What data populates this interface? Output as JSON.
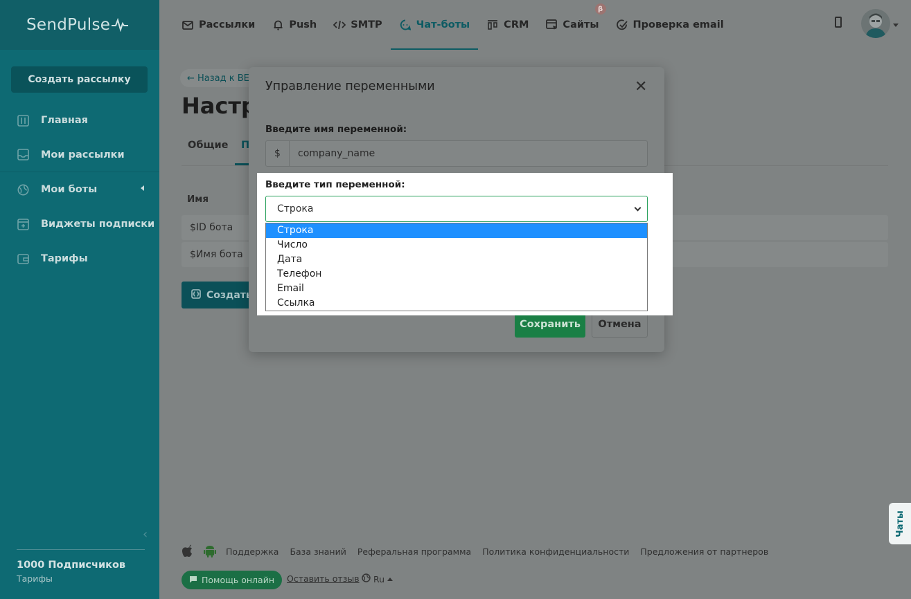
{
  "brand": {
    "logo_text": "SendPulse"
  },
  "sidebar": {
    "create_button": "Создать рассылку",
    "items": [
      {
        "label": "Главная",
        "icon": "dashboard-icon"
      },
      {
        "label": "Мои рассылки",
        "icon": "mailings-icon"
      },
      {
        "label": "Мои боты",
        "icon": "globe-icon"
      },
      {
        "label": "Виджеты подписки",
        "icon": "widget-icon"
      },
      {
        "label": "Тарифы",
        "icon": "wallet-icon"
      }
    ],
    "subscribers": "1000 Подписчиков",
    "tariffs_link": "Тарифы"
  },
  "topnav": {
    "items": [
      {
        "label": "Рассылки",
        "icon": "mail-icon"
      },
      {
        "label": "Push",
        "icon": "bell-icon"
      },
      {
        "label": "SMTP",
        "icon": "code-icon"
      },
      {
        "label": "Чат-боты",
        "icon": "chat-icon"
      },
      {
        "label": "CRM",
        "icon": "crm-icon"
      },
      {
        "label": "Сайты",
        "icon": "site-icon"
      },
      {
        "label": "Проверка email",
        "icon": "check-icon"
      }
    ],
    "beta_badge": "β"
  },
  "page": {
    "back_link": "← Назад к ВЕ",
    "title": "Настро",
    "tabs": [
      "Общие",
      "П"
    ],
    "column_header": "Имя",
    "rows": [
      "$ID бота",
      "$Имя бота"
    ],
    "create_button": "Создать"
  },
  "modal": {
    "title": "Управление переменными",
    "name_label": "Введите имя переменной:",
    "name_prefix": "$",
    "name_value": "company_name",
    "type_label": "Введите тип переменной:",
    "type_selected": "Строка",
    "type_options": [
      "Строка",
      "Число",
      "Дата",
      "Телефон",
      "Email",
      "Ссылка"
    ],
    "save_button": "Сохранить",
    "cancel_button": "Отмена"
  },
  "footer": {
    "links": [
      "Поддержка",
      "База знаний",
      "Реферальная программа",
      "Политика конфиденциальности",
      "Предложения от партнеров"
    ],
    "help_online": "Помощь онлайн",
    "feedback": "Оставить отзыв",
    "language": "Ru"
  },
  "chat_tab": "Чаты",
  "colors": {
    "sidebar": "#0e6a73",
    "accent_green": "#28a05b",
    "selected_option": "#1e90ff"
  }
}
